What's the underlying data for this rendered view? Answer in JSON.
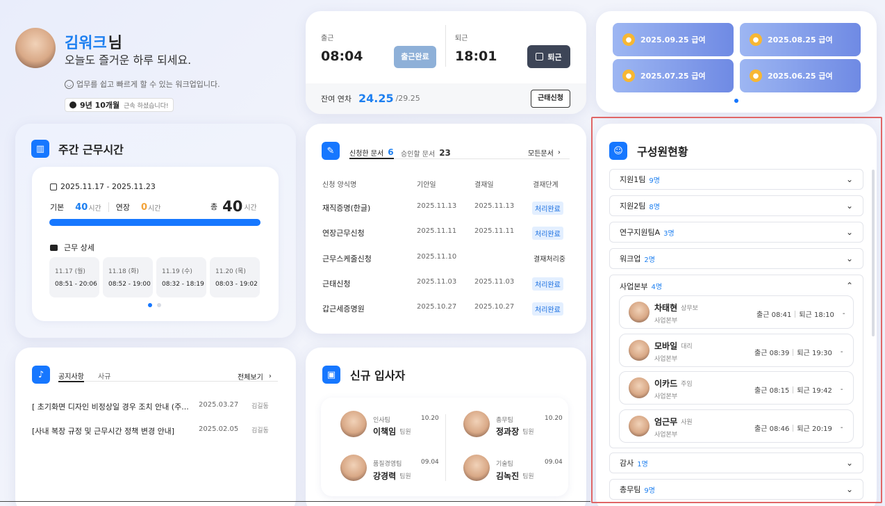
{
  "profile": {
    "name": "김워크",
    "suffix": "님",
    "greeting": "오늘도 즐거운 하루 되세요.",
    "tagline": "업무를 쉽고 빠르게 할 수 있는 워크업입니다.",
    "tenure": "9년 10개월",
    "tenure_suffix": "근속 하셨습니다!"
  },
  "attendance": {
    "in_label": "출근",
    "in_time": "08:04",
    "in_button": "출근완료",
    "out_label": "퇴근",
    "out_time": "18:01",
    "out_button": "퇴근",
    "leave_label": "잔여 연차",
    "leave_remaining": "24.25",
    "leave_total": "/29.25",
    "leave_button": "근태신청"
  },
  "payslips": [
    "2025.09.25 급여",
    "2025.08.25 급여",
    "2025.07.25 급여",
    "2025.06.25 급여"
  ],
  "weekly": {
    "title": "주간 근무시간",
    "range": "2025.11.17 - 2025.11.23",
    "base_label": "기본",
    "base_value": "40",
    "base_unit": "시간",
    "extra_label": "연장",
    "extra_value": "0",
    "extra_unit": "시간",
    "total_label": "총",
    "total_value": "40",
    "total_unit": "시간",
    "progress": 1.0,
    "detail_label": "근무 상세",
    "days": [
      {
        "date": "11.17 (월)",
        "time": "08:51 - 20:06"
      },
      {
        "date": "11.18 (화)",
        "time": "08:52 - 19:00"
      },
      {
        "date": "11.19 (수)",
        "time": "08:32 - 18:19"
      },
      {
        "date": "11.20 (목)",
        "time": "08:03 - 19:02"
      }
    ]
  },
  "documents": {
    "tab_applied": "신청한 문서",
    "tab_applied_count": "6",
    "tab_approve": "승인할 문서",
    "tab_approve_count": "23",
    "all_link": "모든문서",
    "headers": [
      "신청 양식명",
      "기안일",
      "결재일",
      "결재단계"
    ],
    "rows": [
      {
        "name": "재직증명(한글)",
        "draft": "2025.11.13",
        "approved": "2025.11.13",
        "status": "처리완료",
        "done": true
      },
      {
        "name": "연장근무신청",
        "draft": "2025.11.11",
        "approved": "2025.11.11",
        "status": "처리완료",
        "done": true
      },
      {
        "name": "근무스케줄신청",
        "draft": "2025.11.10",
        "approved": "",
        "status": "결재처리중",
        "done": false
      },
      {
        "name": "근태신청",
        "draft": "2025.11.03",
        "approved": "2025.11.03",
        "status": "처리완료",
        "done": true
      },
      {
        "name": "갑근세증명원",
        "draft": "2025.10.27",
        "approved": "2025.10.27",
        "status": "처리완료",
        "done": true
      }
    ]
  },
  "notice": {
    "tab_notice": "공지사항",
    "tab_rule": "사규",
    "all_link": "전체보기",
    "items": [
      {
        "title": "[ 초기화면 디자인 비정상일 경우 조치 안내 (주...",
        "date": "2025.03.27",
        "author": "김길동"
      },
      {
        "title": "[사내 복장 규정 및 근무시간 정책 변경 안내]",
        "date": "2025.02.05",
        "author": "김길동"
      }
    ]
  },
  "newhires": {
    "title": "신규 입사자",
    "people": [
      {
        "team": "인사팀",
        "date": "10.20",
        "name": "이책임",
        "role": "팀원"
      },
      {
        "team": "총무팀",
        "date": "10.20",
        "name": "정과장",
        "role": "팀원"
      },
      {
        "team": "품질경영팀",
        "date": "09.04",
        "name": "강경력",
        "role": "팀원"
      },
      {
        "team": "기술팀",
        "date": "09.04",
        "name": "김녹진",
        "role": "팀원"
      }
    ]
  },
  "members": {
    "title": "구성원현황",
    "groups": [
      {
        "name": "지원1팀",
        "count": "9명"
      },
      {
        "name": "지원2팀",
        "count": "8명"
      },
      {
        "name": "연구지원팀A",
        "count": "3명"
      },
      {
        "name": "워크업",
        "count": "2명"
      },
      {
        "name": "사업본부",
        "count": "4명"
      },
      {
        "name": "감사",
        "count": "1명"
      },
      {
        "name": "총무팀",
        "count": "9명"
      }
    ],
    "people": [
      {
        "name": "차태현",
        "title": "상무보",
        "dept": "사업본부",
        "in": "출근 08:41",
        "out": "퇴근 18:10",
        "extra": "-"
      },
      {
        "name": "모바일",
        "title": "대리",
        "dept": "사업본부",
        "in": "출근 08:39",
        "out": "퇴근 19:30",
        "extra": "-"
      },
      {
        "name": "이카드",
        "title": "주임",
        "dept": "사업본부",
        "in": "출근 08:15",
        "out": "퇴근 19:42",
        "extra": "-"
      },
      {
        "name": "엄근무",
        "title": "사원",
        "dept": "사업본부",
        "in": "출근 08:46",
        "out": "퇴근 20:19",
        "extra": "-"
      }
    ]
  },
  "colors": {
    "accent": "#1677ff",
    "highlight": "#e06666"
  }
}
